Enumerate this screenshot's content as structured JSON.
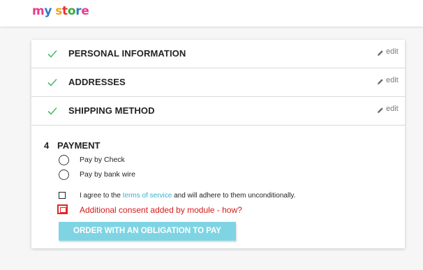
{
  "logo": {
    "letters": [
      {
        "char": "m",
        "color": "#e83a8c"
      },
      {
        "char": "y",
        "color": "#2c7dc8"
      },
      {
        "char": " ",
        "color": "#ffffff"
      },
      {
        "char": "s",
        "color": "#f4a020"
      },
      {
        "char": "t",
        "color": "#e8322c"
      },
      {
        "char": "o",
        "color": "#3aa83a"
      },
      {
        "char": "r",
        "color": "#2c7dc8"
      },
      {
        "char": "e",
        "color": "#e83a8c"
      }
    ]
  },
  "steps": [
    {
      "title": "PERSONAL INFORMATION",
      "edit": "edit",
      "done": true
    },
    {
      "title": "ADDRESSES",
      "edit": "edit",
      "done": true
    },
    {
      "title": "SHIPPING METHOD",
      "edit": "edit",
      "done": true
    }
  ],
  "payment": {
    "number": "4",
    "title": "PAYMENT",
    "options": [
      {
        "label": "Pay by Check",
        "selected": false
      },
      {
        "label": "Pay by bank wire",
        "selected": false
      }
    ],
    "agree_prefix": "I agree to the ",
    "agree_link": "terms of service",
    "agree_suffix": " and will adhere to them unconditionally.",
    "consent": "Additional consent added by module - how?",
    "order_button": "ORDER WITH AN OBLIGATION TO PAY"
  },
  "colors": {
    "check": "#4cbb6c",
    "link": "#2fb5d2",
    "error": "#d51a1a",
    "button_disabled": "#7fd4e4"
  }
}
